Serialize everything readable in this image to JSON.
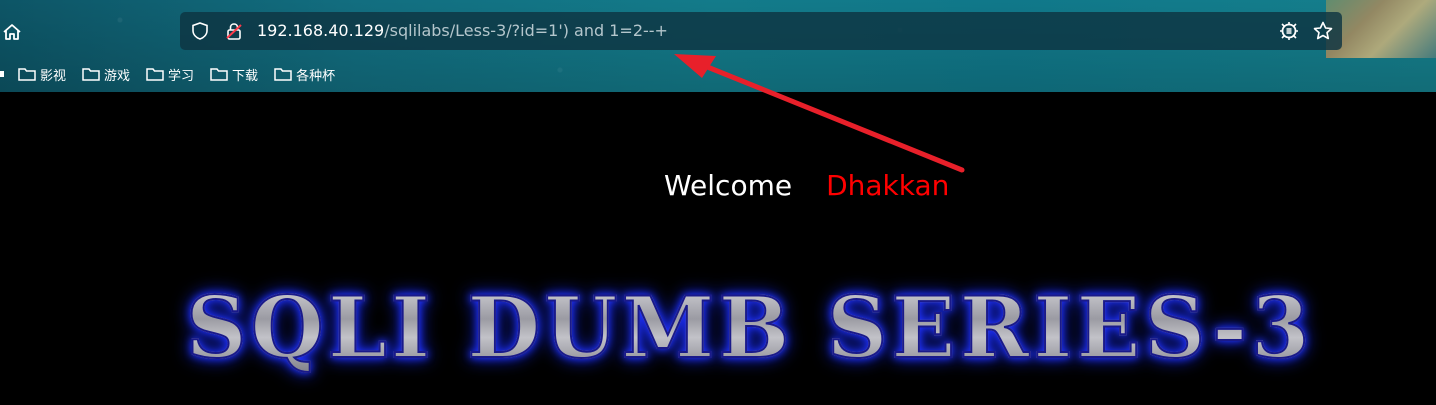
{
  "browser": {
    "url_host": "192.168.40.129",
    "url_path": "/sqlilabs/Less-3/?id=1') and 1=2--+",
    "icons": {
      "home": "home-icon",
      "shield": "shield-icon",
      "lock": "insecure-lock-icon",
      "bug": "extension-icon",
      "star": "bookmark-star-icon"
    }
  },
  "bookmarks": [
    {
      "label": "影视"
    },
    {
      "label": "游戏"
    },
    {
      "label": "学习"
    },
    {
      "label": "下载"
    },
    {
      "label": "各种杯"
    }
  ],
  "page": {
    "welcome_label": "Welcome",
    "name_label": "Dhakkan",
    "banner_text": "SQLI DUMB SERIES-3"
  },
  "colors": {
    "chrome_teal": "#137b8a",
    "url_bar_bg": "#0e3442",
    "name_red": "#ff0000",
    "annotation_arrow": "#e8202a",
    "banner_glow": "#2233ff"
  }
}
